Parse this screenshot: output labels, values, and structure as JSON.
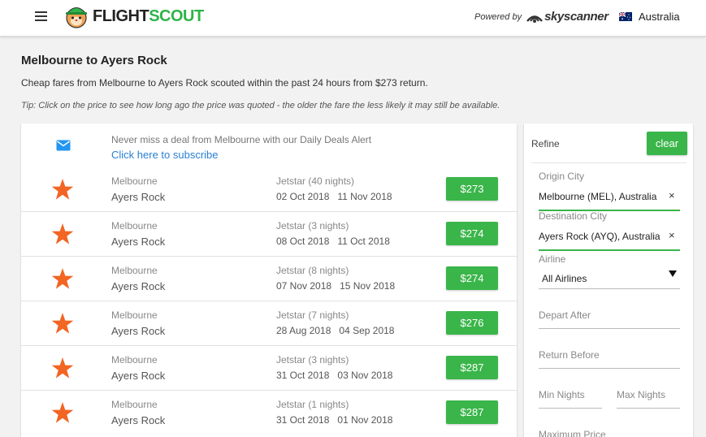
{
  "header": {
    "logo_part1": "FLIGHT",
    "logo_part2": "SCOUT",
    "powered_by": "Powered by",
    "partner": "skyscanner",
    "country": "Australia",
    "brand_green": "#2eb44a"
  },
  "intro": {
    "title": "Melbourne to Ayers Rock",
    "description": "Cheap fares from Melbourne to Ayers Rock scouted within the past 24 hours from $273 return.",
    "tip": "Tip: Click on the price to see how long ago the price was quoted - the older the fare the less likely it may still be available."
  },
  "alert": {
    "text": "Never miss a deal from Melbourne with our Daily Deals Alert",
    "link": "Click here to subscribe",
    "icon": "mail-icon"
  },
  "deals": [
    {
      "from": "Melbourne",
      "to": "Ayers Rock",
      "airline": "Jetstar (40 nights)",
      "depart": "02 Oct 2018",
      "return": "11 Nov 2018",
      "price": "$273"
    },
    {
      "from": "Melbourne",
      "to": "Ayers Rock",
      "airline": "Jetstar (3 nights)",
      "depart": "08 Oct 2018",
      "return": "11 Oct 2018",
      "price": "$274"
    },
    {
      "from": "Melbourne",
      "to": "Ayers Rock",
      "airline": "Jetstar (8 nights)",
      "depart": "07 Nov 2018",
      "return": "15 Nov 2018",
      "price": "$274"
    },
    {
      "from": "Melbourne",
      "to": "Ayers Rock",
      "airline": "Jetstar (7 nights)",
      "depart": "28 Aug 2018",
      "return": "04 Sep 2018",
      "price": "$276"
    },
    {
      "from": "Melbourne",
      "to": "Ayers Rock",
      "airline": "Jetstar (3 nights)",
      "depart": "31 Oct 2018",
      "return": "03 Nov 2018",
      "price": "$287"
    },
    {
      "from": "Melbourne",
      "to": "Ayers Rock",
      "airline": "Jetstar (1 nights)",
      "depart": "31 Oct 2018",
      "return": "01 Nov 2018",
      "price": "$287"
    }
  ],
  "refine": {
    "title": "Refine",
    "clear": "clear",
    "origin_label": "Origin City",
    "origin_value": "Melbourne (MEL), Australia",
    "destination_label": "Destination City",
    "destination_value": "Ayers Rock (AYQ), Australia",
    "airline_label": "Airline",
    "airline_value": "All Airlines",
    "depart_after": "Depart After",
    "return_before": "Return Before",
    "min_nights": "Min Nights",
    "max_nights": "Max Nights",
    "max_price": "Maximum Price",
    "clear_x": "×"
  },
  "colors": {
    "accent_green": "#3ab54a",
    "star_orange": "#f26522",
    "link_blue": "#2a7fd4"
  }
}
